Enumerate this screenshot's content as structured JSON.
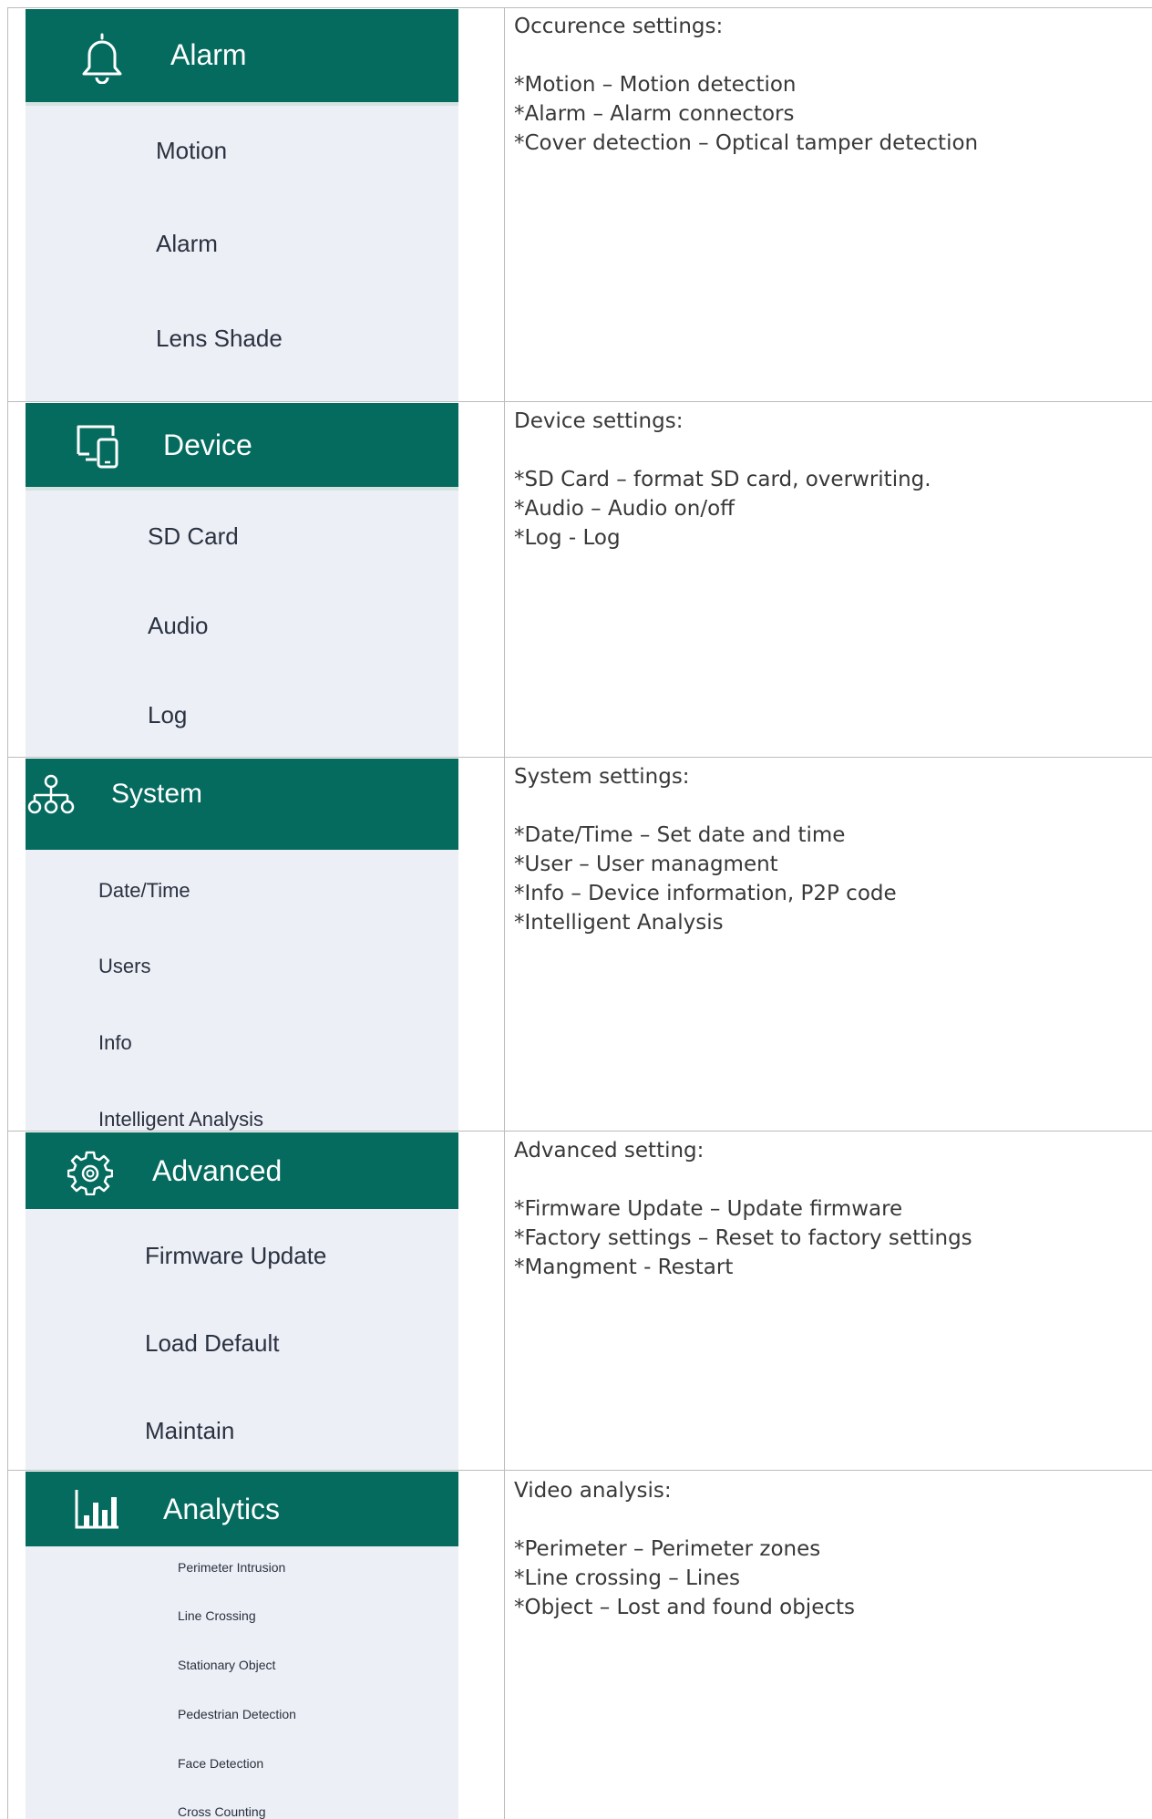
{
  "sections": [
    {
      "title": "Alarm",
      "icon": "bell-icon",
      "items": [
        "Motion",
        "Alarm",
        "Lens Shade"
      ],
      "description_title": "Occurence settings:",
      "description_lines": [
        "*Motion – Motion detection",
        "*Alarm – Alarm connectors",
        "*Cover detection – Optical tamper detection"
      ]
    },
    {
      "title": "Device",
      "icon": "devices-icon",
      "items": [
        "SD Card",
        "Audio",
        "Log"
      ],
      "description_title": "Device settings:",
      "description_lines": [
        "*SD Card – format SD card, overwriting.",
        "*Audio – Audio on/off",
        "*Log - Log"
      ]
    },
    {
      "title": "System",
      "icon": "network-tree-icon",
      "items": [
        "Date/Time",
        "Users",
        "Info",
        "Intelligent Analysis"
      ],
      "description_title": "System settings:",
      "description_lines": [
        "*Date/Time – Set date and time",
        "*User – User managment",
        "*Info – Device information, P2P code",
        "*Intelligent Analysis"
      ]
    },
    {
      "title": "Advanced",
      "icon": "gear-icon",
      "items": [
        "Firmware Update",
        "Load Default",
        "Maintain"
      ],
      "description_title": "Advanced setting:",
      "description_lines": [
        "*Firmware Update – Update firmware",
        "*Factory settings – Reset to factory settings",
        "*Mangment - Restart"
      ]
    },
    {
      "title": "Analytics",
      "icon": "bar-chart-icon",
      "items": [
        "Perimeter Intrusion",
        "Line Crossing",
        "Stationary Object",
        "Pedestrian Detection",
        "Face Detection",
        "Cross Counting"
      ],
      "description_title": "Video analysis:",
      "description_lines": [
        "*Perimeter – Perimeter zones",
        "*Line crossing – Lines",
        "*Object – Lost and found objects"
      ]
    }
  ],
  "colors": {
    "header": "#046b5e",
    "menu_background": "#eceff5",
    "menu_text": "#2a3140",
    "description_text": "#383838",
    "grid_line": "#bcbcbc"
  }
}
